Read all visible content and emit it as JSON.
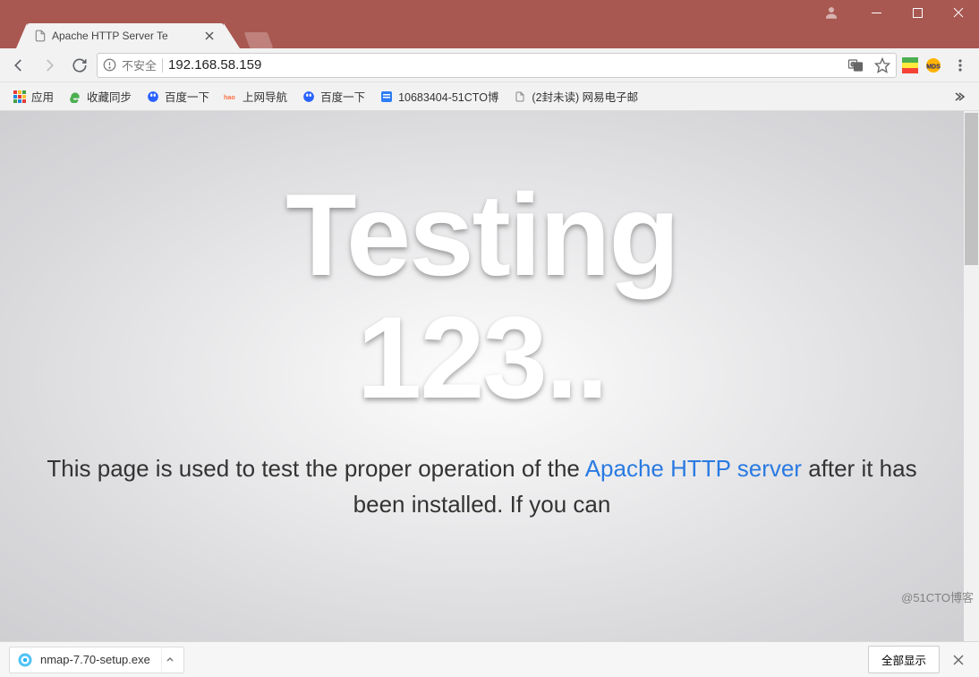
{
  "window": {
    "tab_title": "Apache HTTP Server Te",
    "tab_icon": "file-icon"
  },
  "address": {
    "security_label": "不安全",
    "url": "192.168.58.159"
  },
  "bookmarks": [
    {
      "icon": "apps-icon",
      "label": "应用",
      "color": "#e53935,#fbc02d,#43a047,#1e88e5"
    },
    {
      "icon": "ie-icon",
      "label": "收藏同步",
      "color": "#4caf50"
    },
    {
      "icon": "baidu-icon",
      "label": "百度一下",
      "color": "#2962ff"
    },
    {
      "icon": "hao-icon",
      "label": "上网导航",
      "color": "#ff7043"
    },
    {
      "icon": "baidu-icon",
      "label": "百度一下",
      "color": "#2962ff"
    },
    {
      "icon": "doc-icon",
      "label": "10683404-51CTO博",
      "color": "#2e7cf6"
    },
    {
      "icon": "file-icon",
      "label": "(2封未读) 网易电子邮",
      "color": "#888"
    }
  ],
  "page": {
    "hero_line1": "Testing",
    "hero_line2": "123..",
    "desc_prefix": "This page is used to test the proper operation of the ",
    "desc_link": "Apache HTTP server",
    "desc_suffix": " after it has been installed. If you can"
  },
  "downloads": {
    "item_name": "nmap-7.70-setup.exe",
    "show_all": "全部显示"
  },
  "watermark": "@51CTO博客"
}
